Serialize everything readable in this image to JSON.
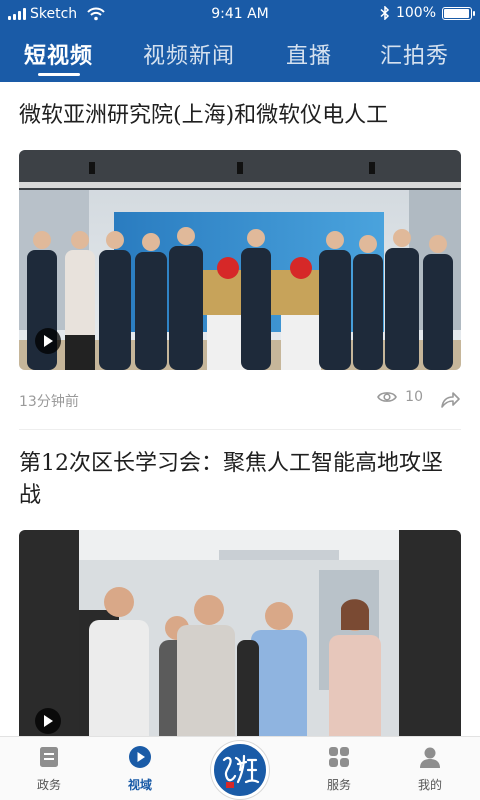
{
  "status_bar": {
    "carrier": "Sketch",
    "time": "9:41 AM",
    "battery": "100%",
    "battery_level": 1.0
  },
  "tabs": [
    {
      "label": "短视频",
      "active": true
    },
    {
      "label": "视频新闻",
      "active": false
    },
    {
      "label": "直播",
      "active": false
    },
    {
      "label": "汇拍秀",
      "active": false
    }
  ],
  "feed": [
    {
      "title": "微软亚洲研究院(上海)和微软仪电人工",
      "time_ago": "13分钟前",
      "views": "10"
    },
    {
      "title": "第12次区长学习会：聚焦人工智能高地攻坚战"
    }
  ],
  "bottom_nav": [
    {
      "label": "政务",
      "icon": "document-icon",
      "active": false
    },
    {
      "label": "视域",
      "icon": "play-circle-icon",
      "active": true
    },
    {
      "label": "",
      "icon": "brand-logo",
      "active": false
    },
    {
      "label": "服务",
      "icon": "grid-icon",
      "active": false
    },
    {
      "label": "我的",
      "icon": "person-icon",
      "active": false
    }
  ],
  "colors": {
    "brand": "#1a5ba7",
    "text": "#1f1f1f",
    "muted": "#9a9a9a"
  }
}
